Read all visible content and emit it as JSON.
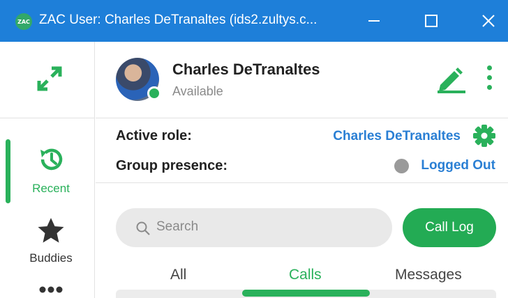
{
  "window": {
    "title": "ZAC User: Charles DeTranaltes (ids2.zultys.c...",
    "logo_text": "ZAC"
  },
  "rail": {
    "items": [
      {
        "label": "Recent",
        "icon": "history-icon",
        "active": true
      },
      {
        "label": "Buddies",
        "icon": "star-icon",
        "active": false
      }
    ]
  },
  "profile": {
    "name": "Charles DeTranaltes",
    "status": "Available"
  },
  "roles": {
    "active_role_label": "Active role:",
    "active_role_value": "Charles DeTranaltes",
    "group_presence_label": "Group presence:",
    "group_presence_value": "Logged Out"
  },
  "search": {
    "placeholder": "Search"
  },
  "call_log_button": "Call Log",
  "tabs": [
    {
      "label": "All",
      "active": false
    },
    {
      "label": "Calls",
      "active": true
    },
    {
      "label": "Messages",
      "active": false
    }
  ],
  "colors": {
    "titlebar": "#1e7fd9",
    "accent_green": "#2ab15b",
    "link_blue": "#2a7fd4"
  }
}
